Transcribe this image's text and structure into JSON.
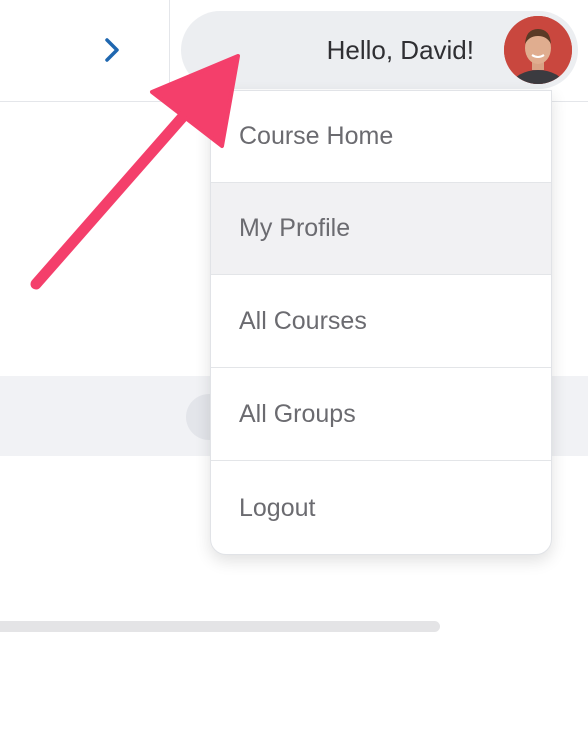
{
  "header": {
    "greeting": "Hello, David!",
    "next_icon": "chevron-right-icon",
    "accent_color": "#1f67b0"
  },
  "user_menu": {
    "items": [
      {
        "label": "Course Home"
      },
      {
        "label": "My Profile",
        "highlighted": true
      },
      {
        "label": "All Courses"
      },
      {
        "label": "All Groups"
      },
      {
        "label": "Logout"
      }
    ]
  },
  "annotation": {
    "arrow_color": "#f43f6b",
    "arrow_icon": "pointer-arrow-icon"
  }
}
